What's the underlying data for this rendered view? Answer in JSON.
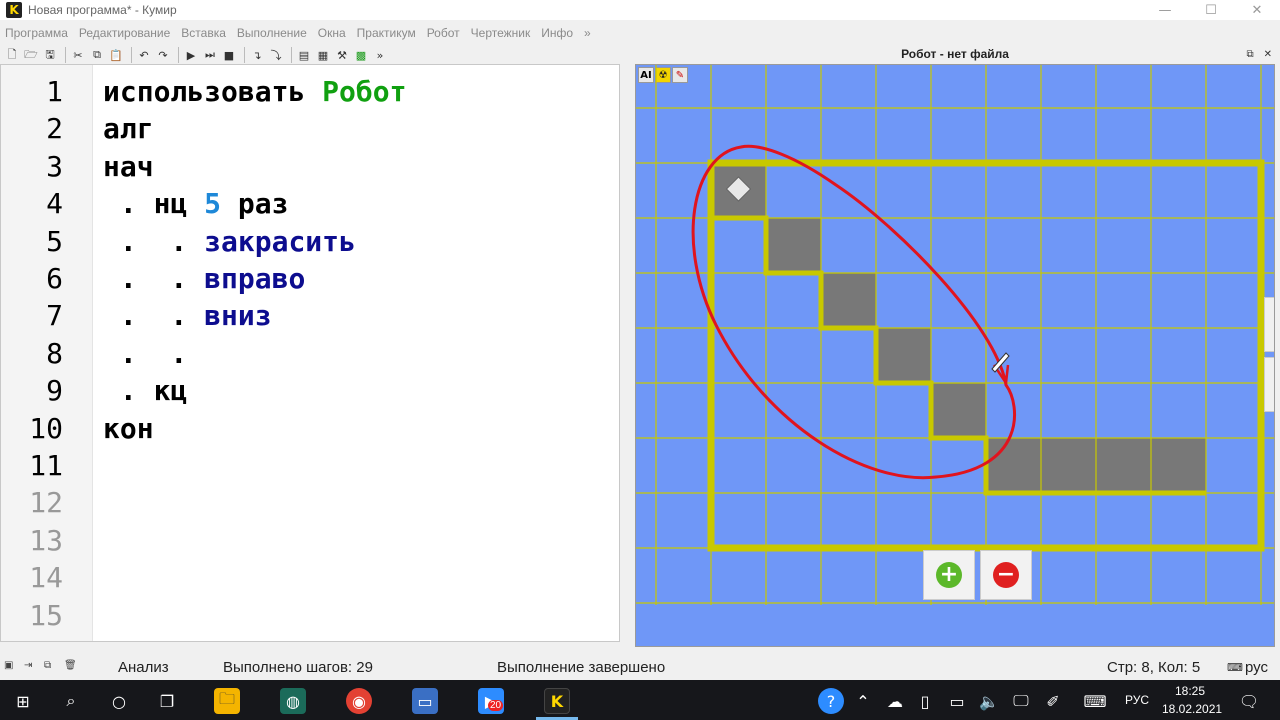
{
  "window": {
    "title": "Новая программа* - Кумир",
    "logo": "K"
  },
  "menu": [
    "Программа",
    "Редактирование",
    "Вставка",
    "Выполнение",
    "Окна",
    "Практикум",
    "Робот",
    "Чертежник",
    "Инфо",
    "»"
  ],
  "toolbar_overflow": "»",
  "editor": {
    "lines": [
      {
        "no": "1",
        "parts": [
          {
            "t": "использовать ",
            "c": "kw"
          },
          {
            "t": "Робот",
            "c": "green"
          }
        ]
      },
      {
        "no": "2",
        "parts": [
          {
            "t": "алг",
            "c": "kw"
          }
        ]
      },
      {
        "no": "3",
        "parts": [
          {
            "t": "нач",
            "c": "kw"
          }
        ]
      },
      {
        "no": "4",
        "parts": [
          {
            "t": " . нц ",
            "c": "kw"
          },
          {
            "t": "5",
            "c": "num"
          },
          {
            "t": " раз",
            "c": "kw"
          }
        ]
      },
      {
        "no": "5",
        "parts": [
          {
            "t": " .  . ",
            "c": "kw"
          },
          {
            "t": "закрасить",
            "c": "cmd"
          }
        ]
      },
      {
        "no": "6",
        "parts": [
          {
            "t": " .  . ",
            "c": "kw"
          },
          {
            "t": "вправо",
            "c": "cmd"
          }
        ]
      },
      {
        "no": "7",
        "parts": [
          {
            "t": " .  . ",
            "c": "kw"
          },
          {
            "t": "вниз",
            "c": "cmd"
          }
        ]
      },
      {
        "no": "8",
        "parts": [
          {
            "t": " .  .",
            "c": "kw"
          }
        ]
      },
      {
        "no": "9",
        "parts": [
          {
            "t": " . кц",
            "c": "kw"
          }
        ]
      },
      {
        "no": "10",
        "parts": [
          {
            "t": "кон",
            "c": "kw"
          }
        ]
      },
      {
        "no": "11",
        "parts": []
      },
      {
        "no": "12",
        "parts": []
      },
      {
        "no": "13",
        "parts": []
      },
      {
        "no": "14",
        "parts": []
      },
      {
        "no": "15",
        "parts": []
      }
    ]
  },
  "robot": {
    "title": "Робот - нет файла",
    "field_tools": [
      "AI",
      "☢",
      "✎"
    ],
    "field_color": "#6f97f7",
    "wall_color": "#c8c800",
    "painted_color": "#787878",
    "zoom_in": "+",
    "zoom_out": "−"
  },
  "status": {
    "mode": "Анализ",
    "steps": "Выполнено шагов: 29",
    "state": "Выполнение завершено",
    "position": "Стр: 8, Кол: 5",
    "lang": "рус"
  },
  "taskbar": {
    "badge": "20",
    "lang": "РУС",
    "time": "18:25",
    "date": "18.02.2021"
  }
}
